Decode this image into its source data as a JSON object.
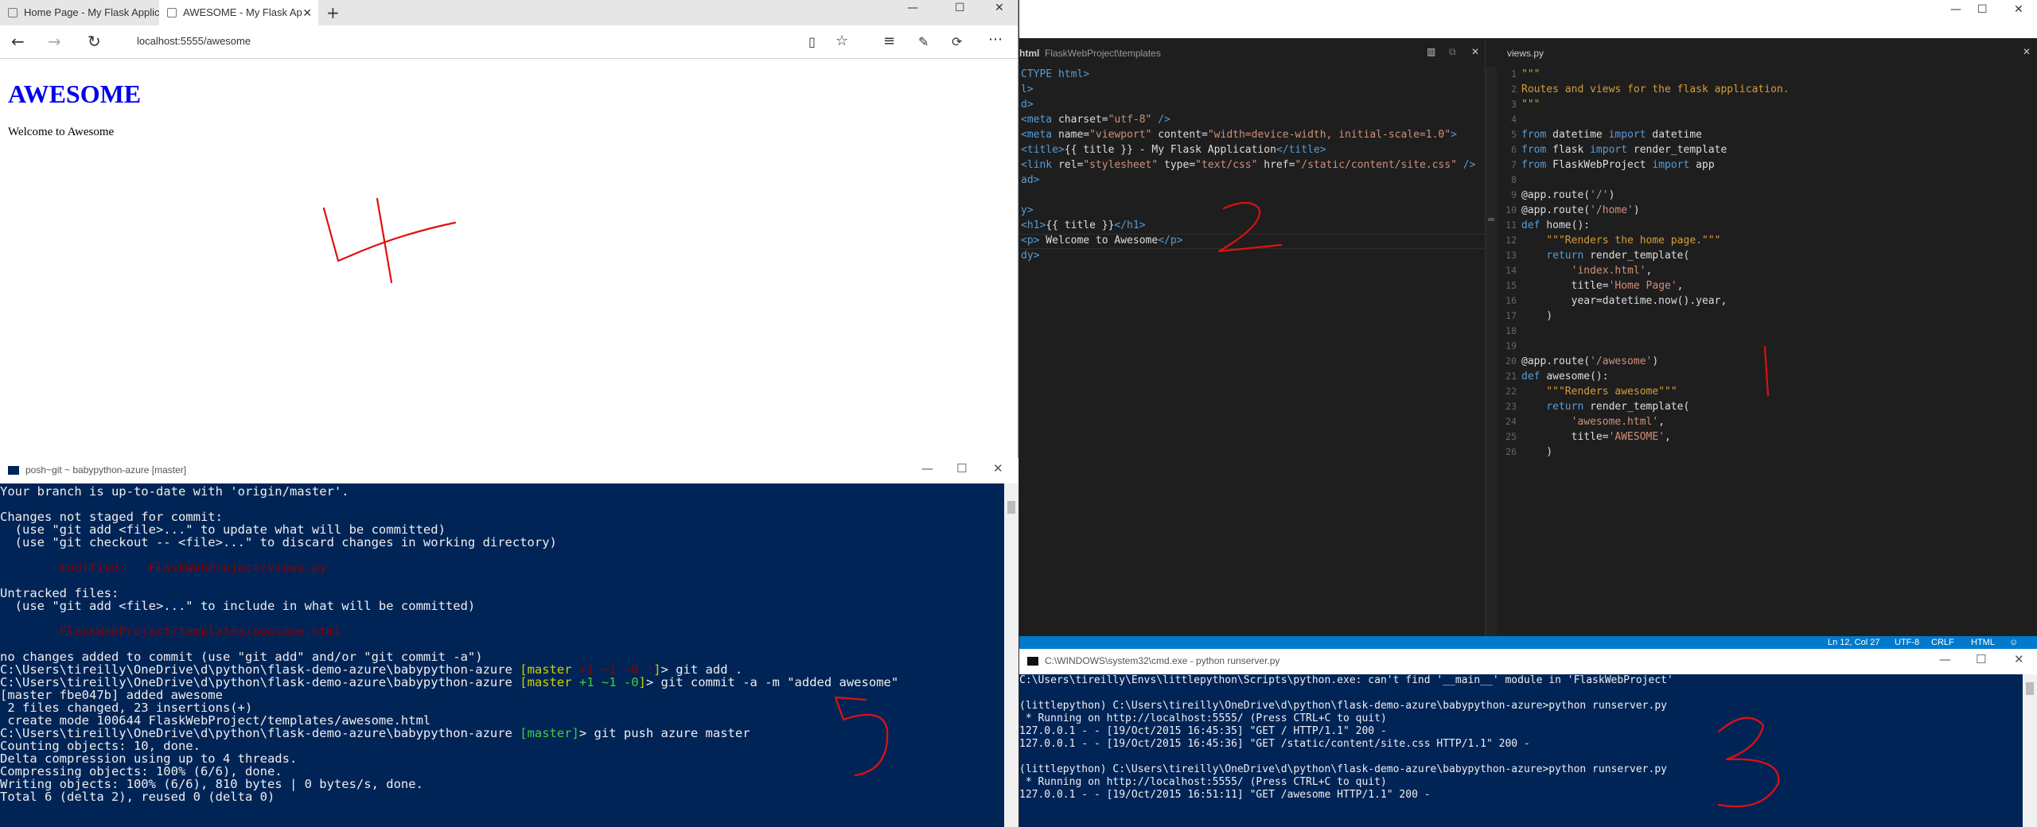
{
  "browser": {
    "tabs": [
      {
        "label": "Home Page - My Flask Applic"
      },
      {
        "label": "AWESOME - My Flask Ap"
      }
    ],
    "new_tab": "+",
    "address": "localhost:5555/awesome",
    "page": {
      "heading": "AWESOME",
      "text": "Welcome to Awesome"
    }
  },
  "git_console": {
    "title": "posh~git ~ babypython-azure [master]",
    "lines": [
      [
        {
          "t": "Your branch is up-to-date with 'origin/master'.",
          "c": ""
        }
      ],
      [
        {
          "t": "",
          "c": ""
        }
      ],
      [
        {
          "t": "Changes not staged for commit:",
          "c": ""
        }
      ],
      [
        {
          "t": "  (use \"git add <file>...\" to update what will be committed)",
          "c": ""
        }
      ],
      [
        {
          "t": "  (use \"git checkout -- <file>...\" to discard changes in working directory)",
          "c": ""
        }
      ],
      [
        {
          "t": "",
          "c": ""
        }
      ],
      [
        {
          "t": "        modified:   FlaskWebProject/views.py",
          "c": "red"
        }
      ],
      [
        {
          "t": "",
          "c": ""
        }
      ],
      [
        {
          "t": "Untracked files:",
          "c": ""
        }
      ],
      [
        {
          "t": "  (use \"git add <file>...\" to include in what will be committed)",
          "c": ""
        }
      ],
      [
        {
          "t": "",
          "c": ""
        }
      ],
      [
        {
          "t": "        FlaskWebProject/templates/awesome.html",
          "c": "red"
        }
      ],
      [
        {
          "t": "",
          "c": ""
        }
      ],
      [
        {
          "t": "no changes added to commit (use \"git add\" and/or \"git commit -a\")",
          "c": ""
        }
      ],
      [
        {
          "t": "C:\\Users\\tireilly\\OneDrive\\d\\python\\flask-demo-azure\\babypython-azure ",
          "c": ""
        },
        {
          "t": "[master ",
          "c": "yel"
        },
        {
          "t": "+1 ~1 -0 !",
          "c": "red"
        },
        {
          "t": "]",
          "c": "yel"
        },
        {
          "t": "> git add .",
          "c": ""
        }
      ],
      [
        {
          "t": "C:\\Users\\tireilly\\OneDrive\\d\\python\\flask-demo-azure\\babypython-azure ",
          "c": ""
        },
        {
          "t": "[master ",
          "c": "yel"
        },
        {
          "t": "+1 ~1 -0",
          "c": "grn"
        },
        {
          "t": "]",
          "c": "yel"
        },
        {
          "t": "> git commit -a -m \"added awesome\"",
          "c": ""
        }
      ],
      [
        {
          "t": "[master fbe047b] added awesome",
          "c": ""
        }
      ],
      [
        {
          "t": " 2 files changed, 23 insertions(+)",
          "c": ""
        }
      ],
      [
        {
          "t": " create mode 100644 FlaskWebProject/templates/awesome.html",
          "c": ""
        }
      ],
      [
        {
          "t": "C:\\Users\\tireilly\\OneDrive\\d\\python\\flask-demo-azure\\babypython-azure ",
          "c": ""
        },
        {
          "t": "[master]",
          "c": "grn"
        },
        {
          "t": "> git push azure master",
          "c": ""
        }
      ],
      [
        {
          "t": "Counting objects: 10, done.",
          "c": ""
        }
      ],
      [
        {
          "t": "Delta compression using up to 4 threads.",
          "c": ""
        }
      ],
      [
        {
          "t": "Compressing objects: 100% (6/6), done.",
          "c": ""
        }
      ],
      [
        {
          "t": "Writing objects: 100% (6/6), 810 bytes | 0 bytes/s, done.",
          "c": ""
        }
      ],
      [
        {
          "t": "Total 6 (delta 2), reused 0 (delta 0)",
          "c": ""
        }
      ]
    ]
  },
  "editor": {
    "left_pane": {
      "title": "html",
      "path": "FlaskWebProject\\templates",
      "lines": [
        [
          {
            "t": "CTYPE html>",
            "c": "k"
          }
        ],
        [
          {
            "t": "l>",
            "c": "k"
          }
        ],
        [
          {
            "t": "d>",
            "c": "k"
          }
        ],
        [
          {
            "t": "<meta ",
            "c": "k"
          },
          {
            "t": "charset=",
            "c": ""
          },
          {
            "t": "\"utf-8\"",
            "c": "s"
          },
          {
            "t": " />",
            "c": "k"
          }
        ],
        [
          {
            "t": "<meta ",
            "c": "k"
          },
          {
            "t": "name=",
            "c": ""
          },
          {
            "t": "\"viewport\"",
            "c": "s"
          },
          {
            "t": " content=",
            "c": ""
          },
          {
            "t": "\"width=device-width, initial-scale=1.0\"",
            "c": "s"
          },
          {
            "t": ">",
            "c": "k"
          }
        ],
        [
          {
            "t": "<title>",
            "c": "k"
          },
          {
            "t": "{{ title }} - My Flask Application",
            "c": ""
          },
          {
            "t": "</title>",
            "c": "k"
          }
        ],
        [
          {
            "t": "<link ",
            "c": "k"
          },
          {
            "t": "rel=",
            "c": ""
          },
          {
            "t": "\"stylesheet\"",
            "c": "s"
          },
          {
            "t": " type=",
            "c": ""
          },
          {
            "t": "\"text/css\"",
            "c": "s"
          },
          {
            "t": " href=",
            "c": ""
          },
          {
            "t": "\"/static/content/site.css\"",
            "c": "s"
          },
          {
            "t": " />",
            "c": "k"
          }
        ],
        [
          {
            "t": "ad>",
            "c": "k"
          }
        ],
        [
          {
            "t": "",
            "c": ""
          }
        ],
        [
          {
            "t": "y>",
            "c": "k"
          }
        ],
        [
          {
            "t": "<h1>",
            "c": "k"
          },
          {
            "t": "{{ title }}",
            "c": ""
          },
          {
            "t": "</h1>",
            "c": "k"
          }
        ],
        [
          {
            "t": "<p>",
            "c": "k"
          },
          {
            "t": " Welcome to Awesome",
            "c": ""
          },
          {
            "t": "</p>",
            "c": "k"
          }
        ],
        [
          {
            "t": "dy>",
            "c": "k"
          }
        ]
      ]
    },
    "right_pane": {
      "title": "views.py",
      "line_numbers": [
        "1",
        "2",
        "3",
        "4",
        "5",
        "6",
        "7",
        "8",
        "9",
        "10",
        "11",
        "12",
        "13",
        "14",
        "15",
        "16",
        "17",
        "18",
        "19",
        "20",
        "21",
        "22",
        "23",
        "24",
        "25",
        "26"
      ],
      "lines": [
        [
          {
            "t": "\"\"\"",
            "c": "c2"
          }
        ],
        [
          {
            "t": "Routes and views for the flask application.",
            "c": "c2"
          }
        ],
        [
          {
            "t": "\"\"\"",
            "c": "c2"
          }
        ],
        [
          {
            "t": "",
            "c": ""
          }
        ],
        [
          {
            "t": "from ",
            "c": "k"
          },
          {
            "t": "datetime ",
            "c": ""
          },
          {
            "t": "import ",
            "c": "k"
          },
          {
            "t": "datetime",
            "c": ""
          }
        ],
        [
          {
            "t": "from ",
            "c": "k"
          },
          {
            "t": "flask ",
            "c": ""
          },
          {
            "t": "import ",
            "c": "k"
          },
          {
            "t": "render_template",
            "c": ""
          }
        ],
        [
          {
            "t": "from ",
            "c": "k"
          },
          {
            "t": "FlaskWebProject ",
            "c": ""
          },
          {
            "t": "import ",
            "c": "k"
          },
          {
            "t": "app",
            "c": ""
          }
        ],
        [
          {
            "t": "",
            "c": ""
          }
        ],
        [
          {
            "t": "@app.route(",
            "c": ""
          },
          {
            "t": "'/'",
            "c": "s"
          },
          {
            "t": ")",
            "c": ""
          }
        ],
        [
          {
            "t": "@app.route(",
            "c": ""
          },
          {
            "t": "'/home'",
            "c": "s"
          },
          {
            "t": ")",
            "c": ""
          }
        ],
        [
          {
            "t": "def ",
            "c": "k"
          },
          {
            "t": "home():",
            "c": ""
          }
        ],
        [
          {
            "t": "    \"\"\"Renders the home page.\"\"\"",
            "c": "c2"
          }
        ],
        [
          {
            "t": "    return ",
            "c": "k"
          },
          {
            "t": "render_template(",
            "c": ""
          }
        ],
        [
          {
            "t": "        'index.html'",
            "c": "s"
          },
          {
            "t": ",",
            "c": ""
          }
        ],
        [
          {
            "t": "        title=",
            "c": ""
          },
          {
            "t": "'Home Page'",
            "c": "s"
          },
          {
            "t": ",",
            "c": ""
          }
        ],
        [
          {
            "t": "        year=datetime.now().year,",
            "c": ""
          }
        ],
        [
          {
            "t": "    )",
            "c": ""
          }
        ],
        [
          {
            "t": "",
            "c": ""
          }
        ],
        [
          {
            "t": "",
            "c": ""
          }
        ],
        [
          {
            "t": "@app.route(",
            "c": ""
          },
          {
            "t": "'/awesome'",
            "c": "s"
          },
          {
            "t": ")",
            "c": ""
          }
        ],
        [
          {
            "t": "def ",
            "c": "k"
          },
          {
            "t": "awesome():",
            "c": ""
          }
        ],
        [
          {
            "t": "    \"\"\"Renders awesome\"\"\"",
            "c": "c2"
          }
        ],
        [
          {
            "t": "    return ",
            "c": "k"
          },
          {
            "t": "render_template(",
            "c": ""
          }
        ],
        [
          {
            "t": "        'awesome.html'",
            "c": "s"
          },
          {
            "t": ",",
            "c": ""
          }
        ],
        [
          {
            "t": "        title=",
            "c": ""
          },
          {
            "t": "'AWESOME'",
            "c": "s"
          },
          {
            "t": ",",
            "c": ""
          }
        ],
        [
          {
            "t": "    )",
            "c": ""
          }
        ]
      ]
    },
    "status": {
      "position": "Ln 12, Col 27",
      "encoding": "UTF-8",
      "eol": "CRLF",
      "language": "HTML"
    }
  },
  "cmd_console": {
    "title": "C:\\WINDOWS\\system32\\cmd.exe - python  runserver.py",
    "lines": [
      "C:\\Users\\tireilly\\Envs\\littlepython\\Scripts\\python.exe: can't find '__main__' module in 'FlaskWebProject'",
      "",
      "(littlepython) C:\\Users\\tireilly\\OneDrive\\d\\python\\flask-demo-azure\\babypython-azure>python runserver.py",
      " * Running on http://localhost:5555/ (Press CTRL+C to quit)",
      "127.0.0.1 - - [19/Oct/2015 16:45:35] \"GET / HTTP/1.1\" 200 -",
      "127.0.0.1 - - [19/Oct/2015 16:45:36] \"GET /static/content/site.css HTTP/1.1\" 200 -",
      "",
      "(littlepython) C:\\Users\\tireilly\\OneDrive\\d\\python\\flask-demo-azure\\babypython-azure>python runserver.py",
      " * Running on http://localhost:5555/ (Press CTRL+C to quit)",
      "127.0.0.1 - - [19/Oct/2015 16:51:11] \"GET /awesome HTTP/1.1\" 200 -"
    ]
  },
  "annotations": {
    "color": "#e01010",
    "marks": [
      "4",
      "2",
      "1",
      "5",
      "3"
    ]
  }
}
